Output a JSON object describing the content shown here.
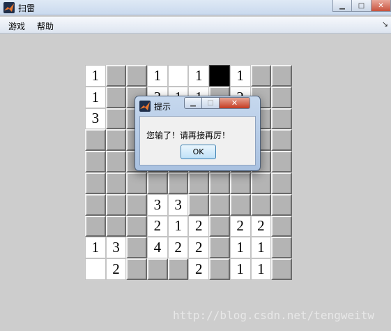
{
  "window": {
    "title": "扫雷",
    "icon": "matlab-icon",
    "buttons": {
      "minimize": "minimize-icon",
      "maximize": "maximize-icon",
      "close": "close-icon"
    }
  },
  "menu": {
    "items": [
      "游戏",
      "帮助"
    ],
    "dock_arrow": "↘"
  },
  "board": {
    "rows": 10,
    "cols": 10,
    "cells": [
      [
        "1",
        "#",
        "#",
        "1",
        " ",
        "1",
        "M",
        "1",
        "#",
        "#"
      ],
      [
        "1",
        "#",
        "#",
        "3",
        "1",
        "1",
        "#",
        "2",
        "#",
        "#"
      ],
      [
        "3",
        "#",
        "#",
        "#",
        "#",
        "#",
        "#",
        "#",
        "#",
        "#"
      ],
      [
        "#",
        "#",
        "#",
        "#",
        "#",
        "#",
        "#",
        "#",
        "#",
        "#"
      ],
      [
        "#",
        "#",
        "#",
        "#",
        "#",
        "#",
        "#",
        "#",
        "#",
        "#"
      ],
      [
        "#",
        "#",
        "#",
        "#",
        "#",
        "#",
        "#",
        "#",
        "#",
        "#"
      ],
      [
        "#",
        "#",
        "#",
        "3",
        "3",
        "#",
        "#",
        "#",
        "#",
        "#"
      ],
      [
        "#",
        "#",
        "#",
        "2",
        "1",
        "2",
        "#",
        "2",
        "2",
        "#"
      ],
      [
        "1",
        "3",
        "#",
        "4",
        "2",
        "2",
        "#",
        "1",
        "1",
        "#"
      ],
      [
        " ",
        "2",
        "#",
        "#",
        "#",
        "2",
        "#",
        "1",
        "1",
        "#"
      ]
    ],
    "legend": {
      "#": "covered",
      "M": "mine",
      " ": "open-empty"
    }
  },
  "dialog": {
    "title": "提示",
    "message": "您输了！请再接再厉！",
    "ok_label": "OK",
    "close_glyph": "✕",
    "min_glyph": "▁",
    "max_glyph": "□"
  },
  "watermark": "http://blog.csdn.net/tengweitw"
}
